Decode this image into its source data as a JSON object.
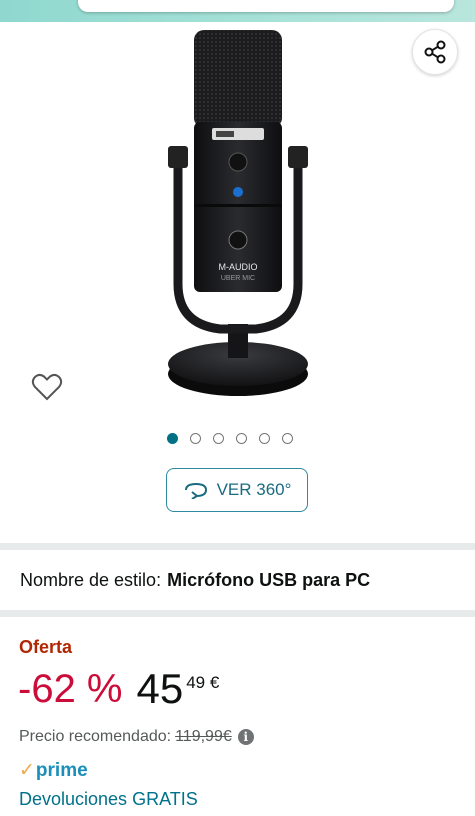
{
  "gallery": {
    "product_brand_text": "M-AUDIO",
    "product_model_text": "UBER MIC",
    "dots": [
      true,
      false,
      false,
      false,
      false,
      false
    ],
    "view360_label": "VER 360°"
  },
  "style": {
    "label": "Nombre de estilo:",
    "value": "Micrófono USB para PC"
  },
  "pricing": {
    "deal_label": "Oferta",
    "discount": "-62 %",
    "price_whole": "45",
    "price_fraction": "49 €",
    "list_price_label": "Precio recomendado:",
    "list_price": "119,99€",
    "info_icon": "i",
    "prime_label": "prime",
    "returns_label": "Devoluciones GRATIS"
  },
  "colors": {
    "accent": "#007185",
    "deal": "#b12704",
    "discount": "#cc0c39",
    "prime": "#1b8fb8"
  }
}
